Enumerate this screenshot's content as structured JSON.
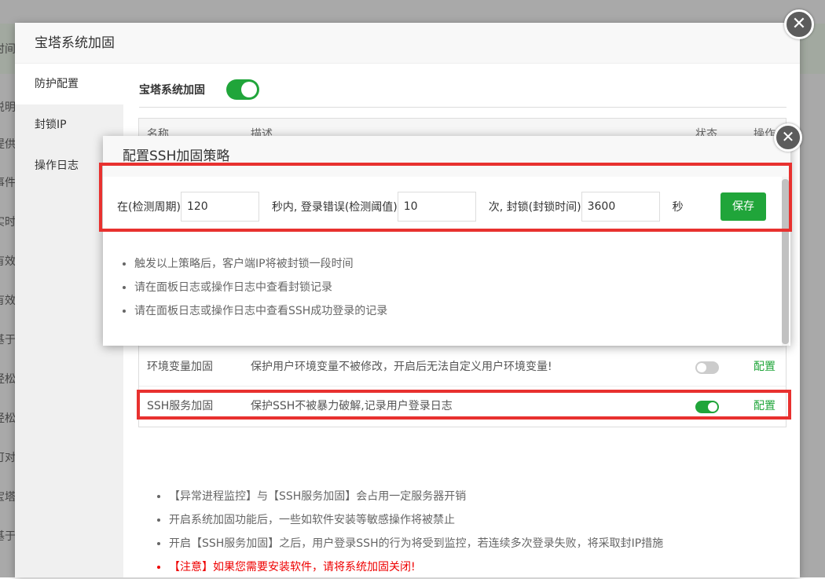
{
  "background": {
    "left_fragments": [
      "时间",
      "说明",
      "提供",
      "事件",
      "实时",
      "有效",
      "有效",
      "基于",
      "经松",
      "经松",
      "可对",
      "宝塔",
      "基于"
    ]
  },
  "outer_dialog": {
    "title": "宝塔系统加固",
    "close_glyph": "✕",
    "sidebar": [
      {
        "label": "防护配置",
        "active": true
      },
      {
        "label": "封锁IP",
        "active": false
      },
      {
        "label": "操作日志",
        "active": false
      }
    ],
    "section_label": "宝塔系统加固",
    "section_enabled": true,
    "table": {
      "headers": [
        "名称",
        "描述",
        "状态",
        "操作"
      ],
      "rows": [
        {
          "name": "环境变量加固",
          "desc": "保护用户环境变量不被修改，开启后无法自定义用户环境变量!",
          "enabled": false,
          "action": "配置"
        },
        {
          "name": "SSH服务加固",
          "desc": "保护SSH不被暴力破解,记录用户登录日志",
          "enabled": true,
          "action": "配置"
        }
      ]
    },
    "notes": [
      "【异常进程监控】与【SSH服务加固】会占用一定服务器开销",
      "开启系统加固功能后，一些如软件安装等敏感操作将被禁止",
      "开启【SSH服务加固】之后，用户登录SSH的行为将受到监控，若连续多次登录失败，将采取封IP措施",
      "【注意】如果您需要安装软件，请将系统加固关闭!"
    ]
  },
  "inner_dialog": {
    "title": "配置SSH加固策略",
    "close_glyph": "✕",
    "form": {
      "label1": "在(检测周期)",
      "value1": "120",
      "label2": "秒内, 登录错误(检测阈值)",
      "value2": "10",
      "label3": "次, 封锁(封锁时间)",
      "value3": "3600",
      "label4": "秒",
      "save": "保存"
    },
    "notes": [
      "触发以上策略后，客户端IP将被封锁一段时间",
      "请在面板日志或操作日志中查看封锁记录",
      "请在面板日志或操作日志中查看SSH成功登录的记录"
    ]
  },
  "colors": {
    "accent": "#20a53a",
    "highlight": "#e8312f",
    "warning": "#e00000"
  }
}
